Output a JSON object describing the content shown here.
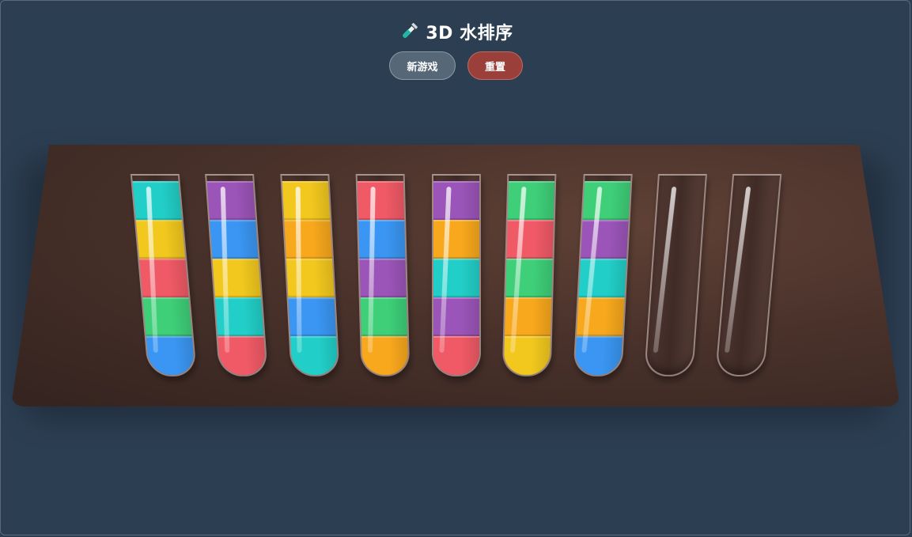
{
  "header": {
    "title": "3D 水排序",
    "icon": "test-tube-icon"
  },
  "controls": {
    "new_game_label": "新游戏",
    "reset_label": "重置"
  },
  "colors": {
    "blue": "#3a96f2",
    "green": "#3ecf78",
    "red": "#f05a66",
    "yellow": "#f2c81e",
    "teal": "#22cfc8",
    "purple": "#9b55b8",
    "orange": "#f8a81c",
    "background": "#2c3e52",
    "board": "#4a322b"
  },
  "tubes": [
    {
      "id": 1,
      "layers_bottom_to_top": [
        "blue",
        "green",
        "red",
        "yellow",
        "teal"
      ]
    },
    {
      "id": 2,
      "layers_bottom_to_top": [
        "red",
        "teal",
        "yellow",
        "blue",
        "purple"
      ]
    },
    {
      "id": 3,
      "layers_bottom_to_top": [
        "teal",
        "blue",
        "yellow",
        "orange",
        "yellow"
      ]
    },
    {
      "id": 4,
      "layers_bottom_to_top": [
        "orange",
        "green",
        "purple",
        "blue",
        "red"
      ]
    },
    {
      "id": 5,
      "layers_bottom_to_top": [
        "red",
        "purple",
        "teal",
        "orange",
        "purple"
      ]
    },
    {
      "id": 6,
      "layers_bottom_to_top": [
        "yellow",
        "orange",
        "green",
        "red",
        "green"
      ]
    },
    {
      "id": 7,
      "layers_bottom_to_top": [
        "blue",
        "orange",
        "teal",
        "purple",
        "green"
      ]
    },
    {
      "id": 8,
      "layers_bottom_to_top": []
    },
    {
      "id": 9,
      "layers_bottom_to_top": []
    }
  ]
}
